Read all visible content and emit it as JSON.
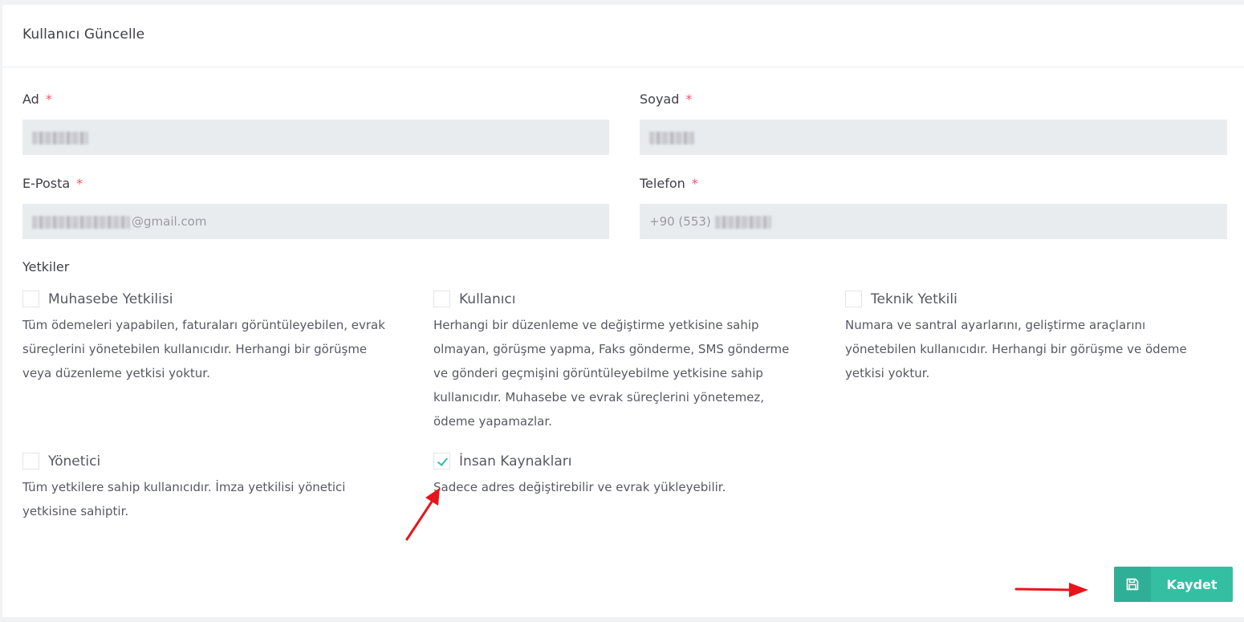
{
  "header": {
    "title": "Kullanıcı Güncelle"
  },
  "form": {
    "ad": {
      "label": "Ad",
      "required_mark": "*",
      "value_suffix": ""
    },
    "soyad": {
      "label": "Soyad",
      "required_mark": "*",
      "value_suffix": ""
    },
    "eposta": {
      "label": "E-Posta",
      "required_mark": "*",
      "value_suffix": "@gmail.com"
    },
    "telefon": {
      "label": "Telefon",
      "required_mark": "*",
      "value_prefix": "+90 (553)"
    }
  },
  "permissions": {
    "heading": "Yetkiler",
    "items": [
      {
        "title": "Muhasebe Yetkilisi",
        "checked": false,
        "lines": [
          "Tüm ödemeleri yapabilen, faturaları görüntüleyebilen, evrak",
          "süreçlerini yönetebilen kullanıcıdır. Herhangi bir görüşme",
          "veya düzenleme yetkisi yoktur."
        ]
      },
      {
        "title": "Kullanıcı",
        "checked": false,
        "lines": [
          "Herhangi bir düzenleme ve değiştirme yetkisine sahip",
          "olmayan, görüşme yapma, Faks gönderme, SMS gönderme",
          "ve gönderi geçmişini görüntüleyebilme yetkisine sahip",
          "kullanıcıdır. Muhasebe ve evrak süreçlerini yönetemez,",
          "ödeme yapamazlar."
        ]
      },
      {
        "title": "Teknik Yetkili",
        "checked": false,
        "lines": [
          "Numara ve santral ayarlarını, geliştirme araçlarını",
          "yönetebilen kullanıcıdır. Herhangi bir görüşme ve ödeme",
          "yetkisi yoktur."
        ]
      },
      {
        "title": "Yönetici",
        "checked": false,
        "lines": [
          "Tüm yetkilere sahip kullanıcıdır. İmza yetkilisi yönetici",
          "yetkisine sahiptir."
        ]
      },
      {
        "title": "İnsan Kaynakları",
        "checked": true,
        "lines": [
          "Sadece adres değiştirebilir ve evrak yükleyebilir."
        ]
      }
    ]
  },
  "actions": {
    "save_label": "Kaydet",
    "save_icon": "floppy-disk-icon"
  },
  "colors": {
    "accent": "#34bfa3",
    "required": "#f4516c",
    "annotation_arrow": "#e8141b"
  }
}
